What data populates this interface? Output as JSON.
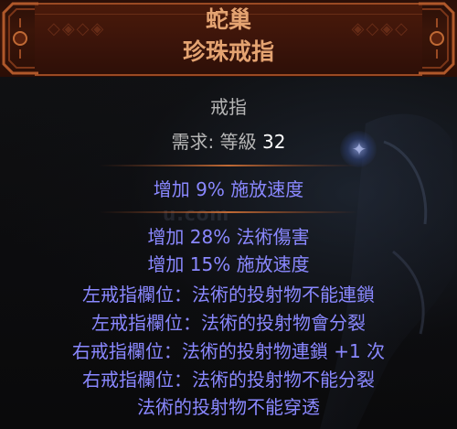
{
  "item": {
    "name": "蛇巢",
    "base_type": "珍珠戒指"
  },
  "properties": {
    "item_class": "戒指",
    "requirement_label": "需求: 等級",
    "requirement_value": "32"
  },
  "implicit_mods": [
    "增加 9% 施放速度"
  ],
  "explicit_mods": [
    "增加 28% 法術傷害",
    "增加 15% 施放速度",
    "左戒指欄位：法術的投射物不能連鎖",
    "左戒指欄位：法術的投射物會分裂",
    "右戒指欄位：法術的投射物連鎖 +1 次",
    "右戒指欄位：法術的投射物不能分裂",
    "法術的投射物不能穿透"
  ],
  "colors": {
    "unique_name": "#e4a371",
    "magic_mod": "#8a88ff",
    "property_text": "#b5b5b5",
    "header_border": "#9a4a23"
  }
}
